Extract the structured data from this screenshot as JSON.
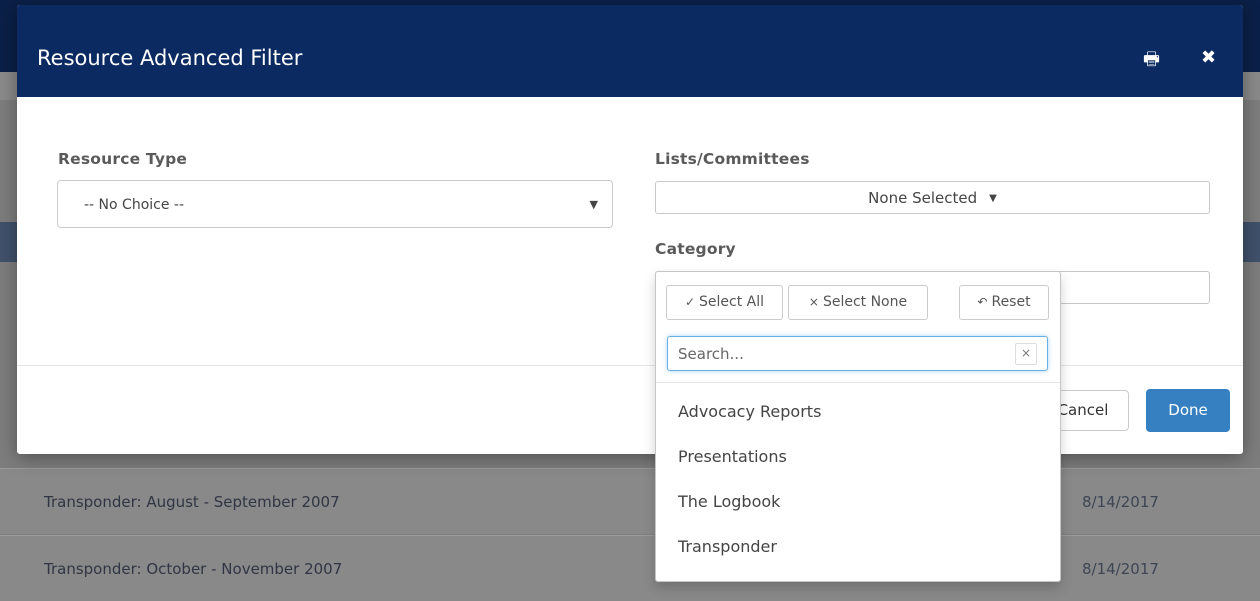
{
  "modal": {
    "title": "Resource Advanced Filter",
    "print_icon": "print-icon",
    "close_icon": "close-icon"
  },
  "resource_type": {
    "label": "Resource Type",
    "selected": "-- No Choice --"
  },
  "lists_committees": {
    "label": "Lists/Committees",
    "selected": "None Selected"
  },
  "category": {
    "label": "Category",
    "dropdown": {
      "select_all": "Select All",
      "select_none": "Select None",
      "reset": "Reset",
      "search_placeholder": "Search...",
      "options": [
        "Advocacy Reports",
        "Presentations",
        "The Logbook",
        "Transponder"
      ]
    }
  },
  "footer": {
    "cancel_label": "Cancel",
    "done_label": "Done"
  },
  "background": {
    "rows": [
      {
        "name": "Transponder: August - September 2007",
        "date": "8/14/2017"
      },
      {
        "name": "Transponder: October - November 2007",
        "date": "8/14/2017"
      }
    ]
  },
  "colors": {
    "header_bg": "#0b2a62",
    "primary_button": "#3680c2",
    "focus_outline": "#66afe9"
  }
}
